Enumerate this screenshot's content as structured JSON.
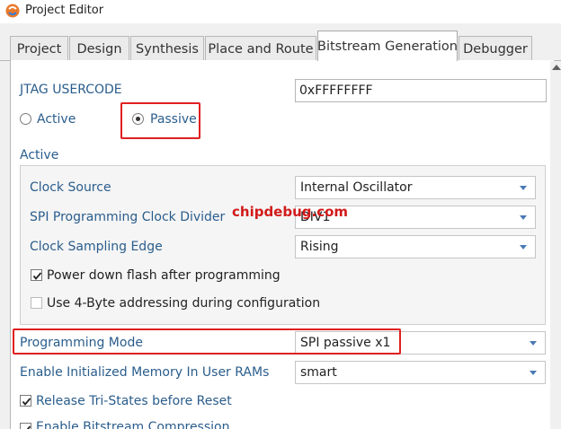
{
  "window": {
    "title": "Project Editor"
  },
  "tabs": [
    {
      "label": "Project"
    },
    {
      "label": "Design"
    },
    {
      "label": "Synthesis"
    },
    {
      "label": "Place and Route"
    },
    {
      "label": "Bitstream Generation"
    },
    {
      "label": "Debugger"
    }
  ],
  "jtag": {
    "label": "JTAG USERCODE",
    "value": "0xFFFFFFFF"
  },
  "mode": {
    "active_label": "Active",
    "passive_label": "Passive",
    "selected": "Passive"
  },
  "active_group": {
    "title": "Active",
    "clock_source": {
      "label": "Clock Source",
      "value": "Internal Oscillator"
    },
    "spi_divider": {
      "label": "SPI Programming Clock Divider",
      "value": "DIV1"
    },
    "clock_edge": {
      "label": "Clock Sampling Edge",
      "value": "Rising"
    },
    "power_down": {
      "label": "Power down flash after programming",
      "checked": true
    },
    "four_byte": {
      "label": "Use 4-Byte addressing during configuration",
      "checked": false
    }
  },
  "programming_mode": {
    "label": "Programming Mode",
    "value": "SPI passive x1"
  },
  "init_memory": {
    "label": "Enable Initialized Memory In User RAMs",
    "value": "smart"
  },
  "release_tristates": {
    "label": "Release Tri-States before Reset",
    "checked": true
  },
  "compression": {
    "label": "Enable Bitstream Compression",
    "checked": true
  },
  "watermark": {
    "text": "chipdebug.com"
  },
  "colors": {
    "label_blue": "#2a5d8c",
    "highlight_red": "#e02020",
    "caret_blue": "#4a7ab4"
  }
}
